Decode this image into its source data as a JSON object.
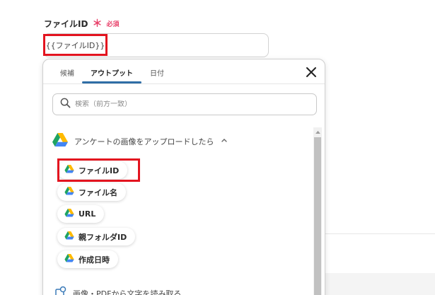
{
  "field": {
    "label": "ファイルID",
    "required_mark": "＊",
    "required_text": "必須",
    "token": "{{ファイルID}}"
  },
  "panel": {
    "tabs": [
      {
        "label": "候補"
      },
      {
        "label": "アウトプット"
      },
      {
        "label": "日付"
      }
    ],
    "active_tab": "アウトプット",
    "search_placeholder": "検索（前方一致）",
    "section_title": "アンケートの画像をアップロードしたら",
    "items": [
      {
        "label": "ファイルID"
      },
      {
        "label": "ファイル名"
      },
      {
        "label": "URL"
      },
      {
        "label": "親フォルダID"
      },
      {
        "label": "作成日時"
      }
    ],
    "section2_title": "画像・PDFから文字を読み取る"
  },
  "colors": {
    "required": "#e8416a",
    "highlight": "#e3141f",
    "tab_underline": "#2f6ea6",
    "drive_green": "#1ea362",
    "drive_blue": "#4285f4",
    "drive_yellow": "#ffba00"
  },
  "icons": {
    "close": "close-icon",
    "search": "search-icon",
    "drive": "google-drive-icon",
    "chevron": "chevron-up-icon",
    "ocr": "document-scan-icon"
  }
}
